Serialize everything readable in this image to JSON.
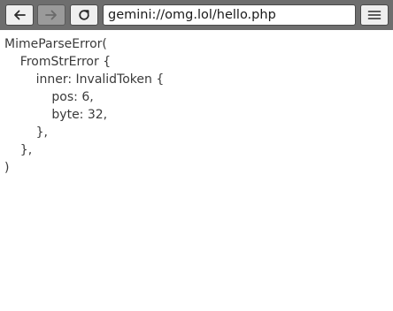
{
  "toolbar": {
    "back_icon": "arrow-left-icon",
    "forward_icon": "arrow-right-icon",
    "reload_icon": "reload-icon",
    "menu_icon": "hamburger-menu-icon",
    "forward_enabled": false
  },
  "address_bar": {
    "value": "gemini://omg.lol/hello.php"
  },
  "content": {
    "lines": [
      "MimeParseError(",
      "    FromStrError {",
      "        inner: InvalidToken {",
      "            pos: 6,",
      "            byte: 32,",
      "        },",
      "    },",
      ")"
    ]
  },
  "colors": {
    "toolbar_bg": "#6e6e6e",
    "button_bg": "#efefef",
    "button_disabled_bg": "#9a9a9a",
    "text": "#3a3a3a"
  }
}
